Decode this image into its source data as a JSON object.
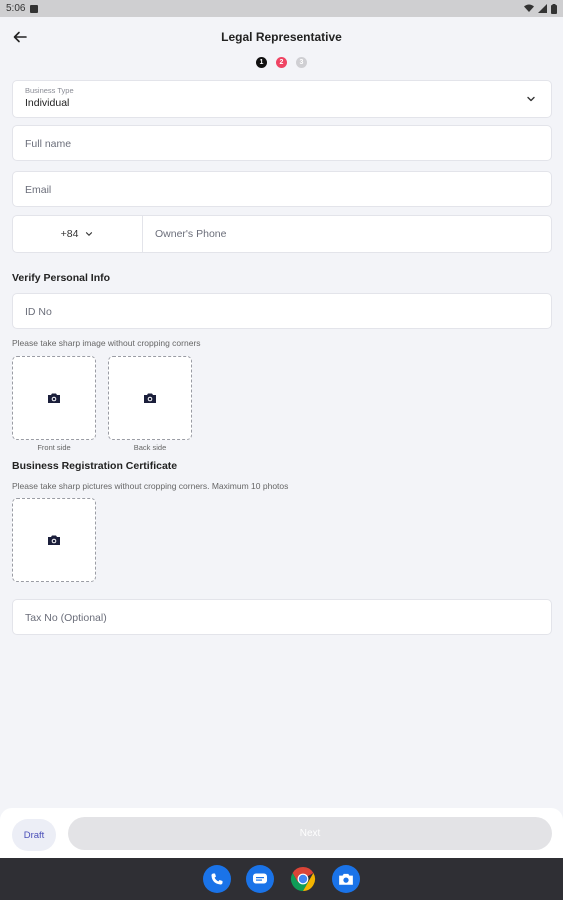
{
  "status_bar": {
    "time": "5:06"
  },
  "header": {
    "title": "Legal Representative"
  },
  "steps": [
    "1",
    "2",
    "3"
  ],
  "business_type": {
    "label": "Business Type",
    "value": "Individual"
  },
  "full_name": {
    "placeholder": "Full name"
  },
  "email": {
    "placeholder": "Email"
  },
  "phone": {
    "country_code": "+84",
    "placeholder": "Owner's Phone"
  },
  "verify": {
    "title": "Verify Personal Info",
    "id_placeholder": "ID No",
    "hint": "Please take sharp image without cropping corners",
    "front_caption": "Front side",
    "back_caption": "Back side"
  },
  "brc": {
    "title": "Business Registration Certificate",
    "hint": "Please take sharp pictures without cropping corners. Maximum 10 photos"
  },
  "tax": {
    "placeholder": "Tax No (Optional)"
  },
  "footer": {
    "draft_label": "Draft",
    "next_label": "Next"
  },
  "colors": {
    "accent": "#4a4fb8",
    "step_active": "#ef4463",
    "nav_bg": "#2f2f34"
  },
  "dock_icons": [
    "phone-icon",
    "messages-icon",
    "chrome-icon",
    "camera-icon"
  ]
}
